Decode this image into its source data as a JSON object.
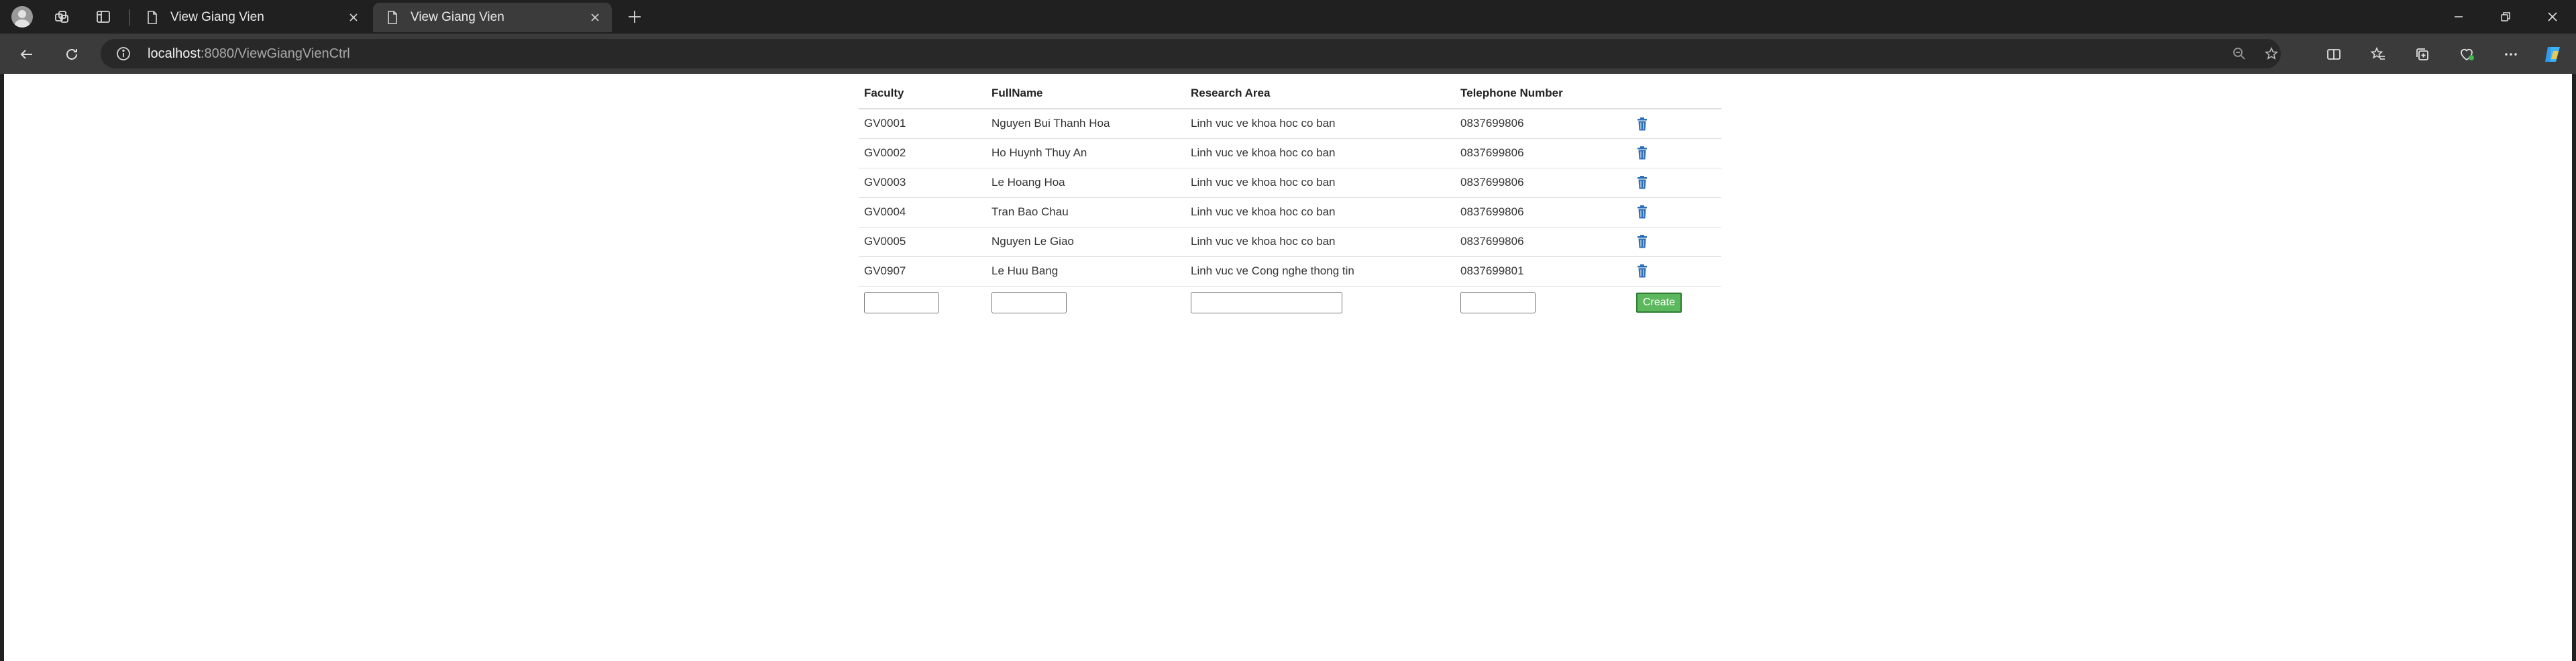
{
  "browser": {
    "tabs": [
      {
        "title": "View Giang Vien",
        "active": false
      },
      {
        "title": "View Giang Vien",
        "active": true
      }
    ],
    "address": {
      "host": "localhost",
      "path": ":8080/ViewGiangVienCtrl"
    }
  },
  "table": {
    "headers": {
      "faculty": "Faculty",
      "fullname": "FullName",
      "research": "Research Area",
      "phone": "Telephone Number"
    },
    "rows": [
      {
        "faculty": "GV0001",
        "fullname": "Nguyen Bui Thanh Hoa",
        "research": "Linh vuc ve khoa hoc co ban",
        "phone": "0837699806"
      },
      {
        "faculty": "GV0002",
        "fullname": "Ho Huynh Thuy An",
        "research": "Linh vuc ve khoa hoc co ban",
        "phone": "0837699806"
      },
      {
        "faculty": "GV0003",
        "fullname": "Le Hoang Hoa",
        "research": "Linh vuc ve khoa hoc co ban",
        "phone": "0837699806"
      },
      {
        "faculty": "GV0004",
        "fullname": "Tran Bao Chau",
        "research": "Linh vuc ve khoa hoc co ban",
        "phone": "0837699806"
      },
      {
        "faculty": "GV0005",
        "fullname": "Nguyen Le Giao",
        "research": "Linh vuc ve khoa hoc co ban",
        "phone": "0837699806"
      },
      {
        "faculty": "GV0907",
        "fullname": "Le Huu Bang",
        "research": "Linh vuc ve Cong nghe thong tin",
        "phone": "0837699801"
      }
    ],
    "create_label": "Create"
  },
  "colors": {
    "delete_icon": "#2f6fb6",
    "create_button": "#5cb85c"
  }
}
